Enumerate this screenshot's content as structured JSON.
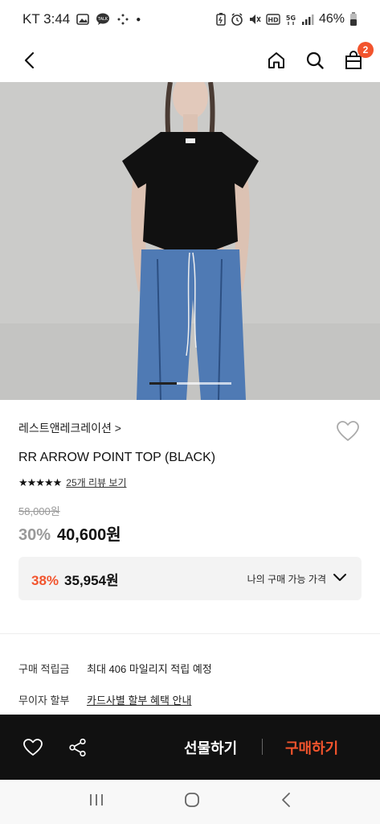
{
  "status_bar": {
    "carrier_time": "KT 3:44",
    "battery": "46%",
    "icons_left": [
      "gallery-icon",
      "talk-icon",
      "dots-icon"
    ],
    "icons_right": [
      "battery-saver-icon",
      "alarm-icon",
      "mute-icon",
      "hd-icon",
      "5g-icon",
      "signal-icon"
    ]
  },
  "header": {
    "cart_count": "2"
  },
  "product": {
    "brand": "레스트앤레크레이션 >",
    "title": "RR ARROW POINT TOP (BLACK)",
    "rating_stars": "★★★★★",
    "rating": 5,
    "review_link": "25개 리뷰 보기",
    "original_price": "58,000원",
    "discount": "30%",
    "sale_price": "40,600원",
    "image_index": 1,
    "image_count": 3
  },
  "my_price": {
    "discount": "38%",
    "price": "35,954원",
    "label": "나의 구매 가능 가격"
  },
  "info": {
    "points_label": "구매 적립금",
    "points_value": "최대 406 마일리지 적립 예정",
    "installment_label": "무이자 할부",
    "installment_value": "카드사별 할부 혜택 안내"
  },
  "bottom_bar": {
    "gift_label": "선물하기",
    "buy_label": "구매하기"
  },
  "colors": {
    "accent": "#f2542d",
    "bar": "#111111"
  }
}
